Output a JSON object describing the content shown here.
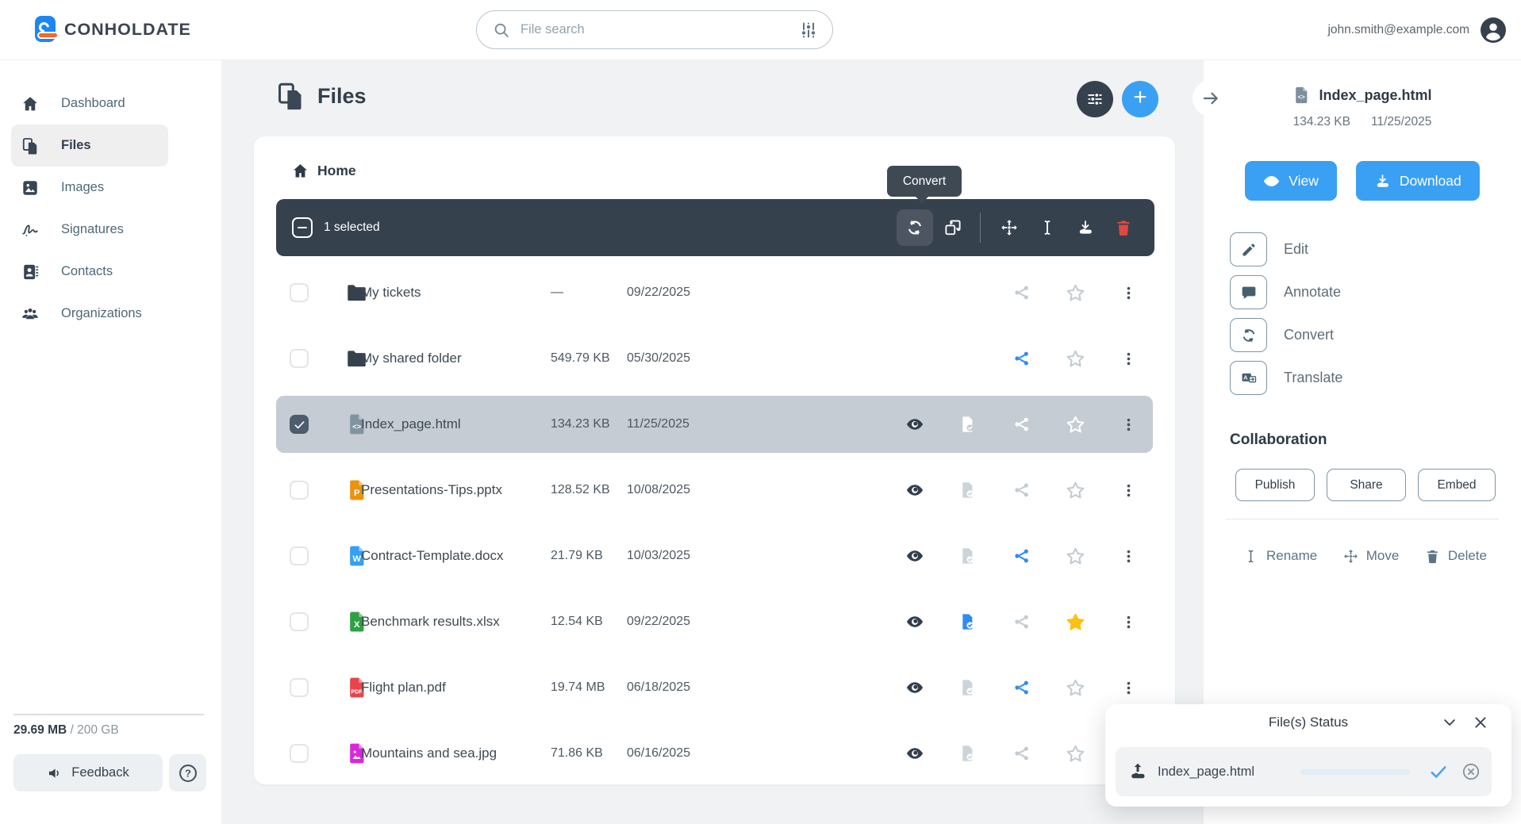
{
  "colors": {
    "accent_blue": "#3aa0f4",
    "slate_dark": "#36414e",
    "selected_row_bg": "#c5ccd3",
    "star_yellow": "#fcc211",
    "delete_red": "#e0493d",
    "share_blue": "#2e8cf0",
    "progress_blue": "#3598ed"
  },
  "topbar": {
    "brand": "CONHOLDATE",
    "search_placeholder": "File search",
    "user_email": "john.smith@example.com"
  },
  "sidebar": {
    "items": [
      {
        "label": "Dashboard",
        "icon": "home",
        "active": false
      },
      {
        "label": "Files",
        "icon": "files",
        "active": true
      },
      {
        "label": "Images",
        "icon": "image",
        "active": false
      },
      {
        "label": "Signatures",
        "icon": "signature",
        "active": false
      },
      {
        "label": "Contacts",
        "icon": "contacts",
        "active": false
      },
      {
        "label": "Organizations",
        "icon": "people",
        "active": false
      }
    ],
    "storage_used": "29.69 MB",
    "storage_total": " / 200 GB",
    "feedback_label": "Feedback"
  },
  "main": {
    "title": "Files",
    "breadcrumb_home": "Home",
    "selection": {
      "label": "1 selected",
      "tools": [
        "convert",
        "merge",
        "divider",
        "move",
        "rename",
        "download",
        "delete"
      ]
    },
    "tooltip": "Convert",
    "files": [
      {
        "name": "My tickets",
        "type": "folder",
        "size": "—",
        "date": "09/22/2025",
        "selected": false,
        "eye": false,
        "file_badge": null,
        "share": "gray",
        "star": "off"
      },
      {
        "name": "My shared folder",
        "type": "folder",
        "size": "549.79 KB",
        "date": "05/30/2025",
        "selected": false,
        "eye": false,
        "file_badge": null,
        "share": "blue",
        "star": "off"
      },
      {
        "name": "Index_page.html",
        "type": "html",
        "size": "134.23 KB",
        "date": "11/25/2025",
        "selected": true,
        "eye": true,
        "file_badge": "white",
        "share": "white",
        "star": "white"
      },
      {
        "name": "Presentations-Tips.pptx",
        "type": "pptx",
        "size": "128.52 KB",
        "date": "10/08/2025",
        "selected": false,
        "eye": true,
        "file_badge": "gray",
        "share": "gray",
        "star": "off"
      },
      {
        "name": "Contract-Template.docx",
        "type": "docx",
        "size": "21.79 KB",
        "date": "10/03/2025",
        "selected": false,
        "eye": true,
        "file_badge": "gray",
        "share": "blue",
        "star": "off"
      },
      {
        "name": "Benchmark results.xlsx",
        "type": "xlsx",
        "size": "12.54 KB",
        "date": "09/22/2025",
        "selected": false,
        "eye": true,
        "file_badge": "blue",
        "share": "gray",
        "star": "on"
      },
      {
        "name": "Flight plan.pdf",
        "type": "pdf",
        "size": "19.74 MB",
        "date": "06/18/2025",
        "selected": false,
        "eye": true,
        "file_badge": "gray",
        "share": "blue",
        "star": "off"
      },
      {
        "name": "Mountains and sea.jpg",
        "type": "jpg",
        "size": "71.86 KB",
        "date": "06/16/2025",
        "selected": false,
        "eye": true,
        "file_badge": "gray",
        "share": "gray",
        "star": "off"
      }
    ]
  },
  "details": {
    "file_name": "Index_page.html",
    "file_size": "134.23 KB",
    "file_date": "11/25/2025",
    "view_label": "View",
    "download_label": "Download",
    "actions": [
      {
        "label": "Edit",
        "icon": "pencil"
      },
      {
        "label": "Annotate",
        "icon": "comment"
      },
      {
        "label": "Convert",
        "icon": "convert"
      },
      {
        "label": "Translate",
        "icon": "translate"
      }
    ],
    "collaboration_title": "Collaboration",
    "collab_buttons": [
      "Publish",
      "Share",
      "Embed"
    ],
    "bottom_actions": [
      {
        "label": "Rename",
        "icon": "rename"
      },
      {
        "label": "Move",
        "icon": "move"
      },
      {
        "label": "Delete",
        "icon": "trash"
      }
    ]
  },
  "status_panel": {
    "title": "File(s) Status",
    "item_name": "Index_page.html",
    "progress_percent": 100
  }
}
